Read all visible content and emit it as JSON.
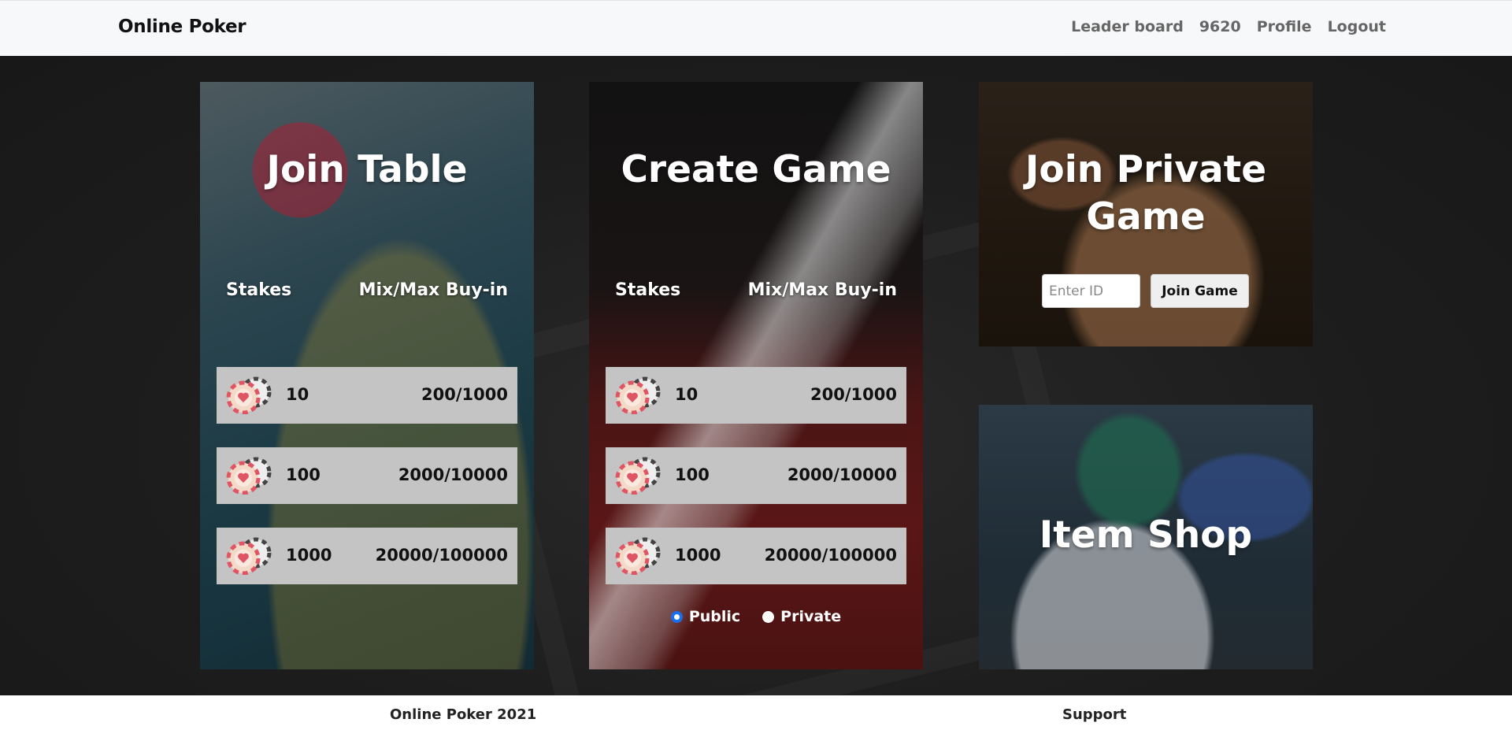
{
  "navbar": {
    "brand": "Online Poker",
    "links": [
      "Leader board",
      "9620",
      "Profile",
      "Logout"
    ]
  },
  "join_table": {
    "title": "Join Table",
    "col_stakes": "Stakes",
    "col_buyin": "Mix/Max Buy-in",
    "rows": [
      {
        "stake": "10",
        "buyin": "200/1000"
      },
      {
        "stake": "100",
        "buyin": "2000/10000"
      },
      {
        "stake": "1000",
        "buyin": "20000/100000"
      }
    ]
  },
  "create_game": {
    "title": "Create Game",
    "col_stakes": "Stakes",
    "col_buyin": "Mix/Max Buy-in",
    "rows": [
      {
        "stake": "10",
        "buyin": "200/1000"
      },
      {
        "stake": "100",
        "buyin": "2000/10000"
      },
      {
        "stake": "1000",
        "buyin": "20000/100000"
      }
    ],
    "visibility_options": [
      "Public",
      "Private"
    ],
    "visibility_selected": "Public"
  },
  "join_private": {
    "title_line1": "Join Private",
    "title_line2": "Game",
    "input_placeholder": "Enter ID",
    "button_label": "Join Game"
  },
  "item_shop": {
    "title": "Item Shop"
  },
  "footer": {
    "left": "Online Poker 2021",
    "right": "Support"
  },
  "colors": {
    "row_bg": "#c4c4c4",
    "radio_accent": "#1a6ef0",
    "navbar_bg": "#f7f8fa"
  }
}
